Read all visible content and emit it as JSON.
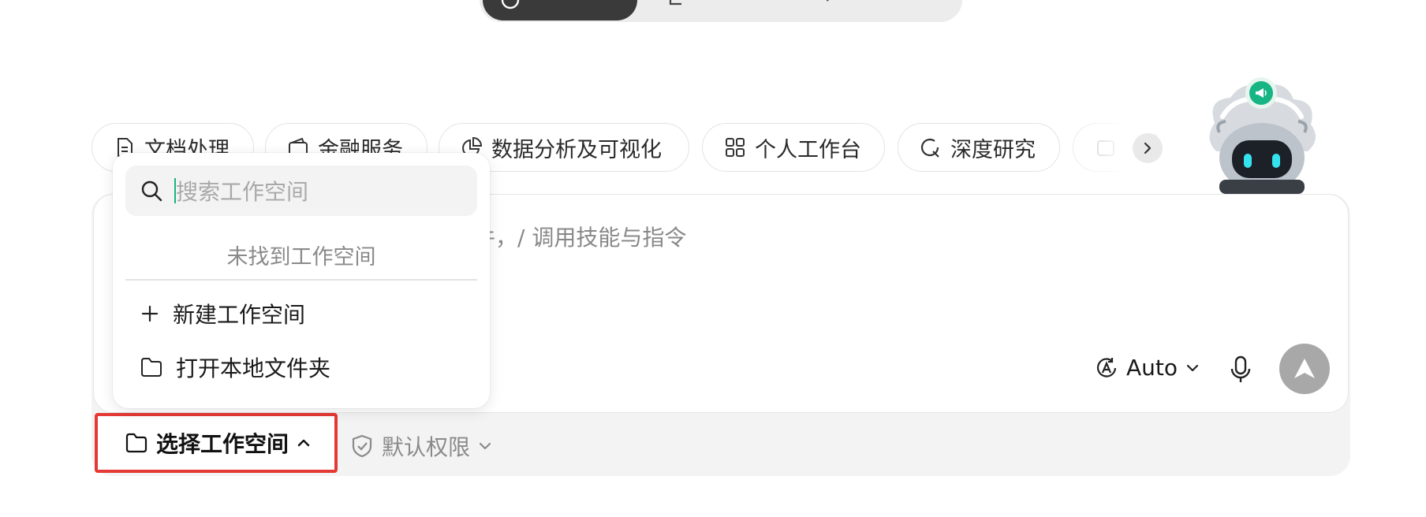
{
  "top_tabs": {
    "active": "",
    "items": [
      "",
      "",
      ""
    ]
  },
  "quick_chips": [
    {
      "label": "文档处理",
      "icon": "document-icon"
    },
    {
      "label": "金融服务",
      "icon": "wallet-icon"
    },
    {
      "label": "数据分析及可视化",
      "icon": "pie-chart-icon"
    },
    {
      "label": "个人工作台",
      "icon": "grid-icon"
    },
    {
      "label": "深度研究",
      "icon": "research-icon"
    }
  ],
  "composer": {
    "placeholder_visible": "件，/ 调用技能与指令",
    "model": "Auto"
  },
  "workspace_dropdown": {
    "search_placeholder": "搜索工作空间",
    "empty_text": "未找到工作空间",
    "items": [
      {
        "label": "新建工作空间",
        "icon": "plus-icon"
      },
      {
        "label": "打开本地文件夹",
        "icon": "folder-icon"
      }
    ]
  },
  "bottom_bar": {
    "workspace_label": "选择工作空间",
    "permission_label": "默认权限"
  },
  "colors": {
    "accent_green": "#17b584",
    "highlight_red": "#e53935",
    "send_button": "#a8a8a8"
  }
}
